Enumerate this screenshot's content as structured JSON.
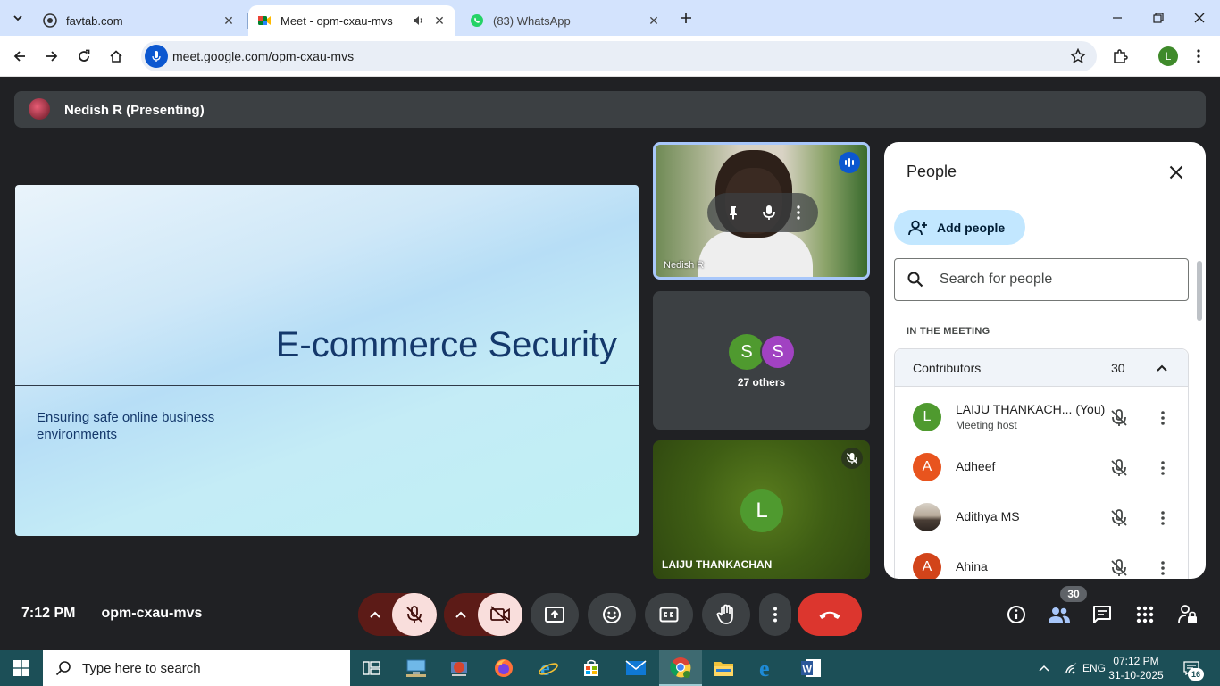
{
  "browser": {
    "tabs": [
      {
        "title": "favtab.com",
        "active": false
      },
      {
        "title": "Meet - opm-cxau-mvs",
        "active": true
      },
      {
        "title": "(83) WhatsApp",
        "active": false
      }
    ],
    "url": "meet.google.com/opm-cxau-mvs",
    "profile_initial": "L"
  },
  "meet": {
    "presenter_label": "Nedish R (Presenting)",
    "slide": {
      "title": "E-commerce Security",
      "subtitle": "Ensuring safe online business environments"
    },
    "tiles": {
      "presenter_name": "Nedish R",
      "others": {
        "avatars": [
          "S",
          "S"
        ],
        "label": "27 others"
      },
      "laiju": {
        "initial": "L",
        "name": "LAIJU THANKACHAN"
      }
    },
    "people_panel": {
      "title": "People",
      "add_people_label": "Add people",
      "search_placeholder": "Search for people",
      "section_label": "IN THE MEETING",
      "group_label": "Contributors",
      "group_count": "30",
      "participants": [
        {
          "initial": "L",
          "name": "LAIJU THANKACH... (You)",
          "role": "Meeting host",
          "color": "#4f9a2f"
        },
        {
          "initial": "A",
          "name": "Adheef",
          "role": "",
          "color": "#e8541e"
        },
        {
          "initial": "",
          "name": "Adithya MS",
          "role": "",
          "color": "#6b6158"
        },
        {
          "initial": "A",
          "name": "Ahina",
          "role": "",
          "color": "#d2441a"
        }
      ]
    },
    "controls": {
      "time": "7:12 PM",
      "meeting_code": "opm-cxau-mvs",
      "people_badge": "30"
    }
  },
  "taskbar": {
    "search_placeholder": "Type here to search",
    "language": "ENG",
    "time": "07:12 PM",
    "date": "31-10-2025",
    "notifications": "16"
  },
  "colors": {
    "meet_bg": "#202124",
    "accent_blue": "#0b57d0",
    "mute_red": "#f9dedc",
    "end_call": "#dc362e",
    "taskbar": "#1c4f57"
  }
}
